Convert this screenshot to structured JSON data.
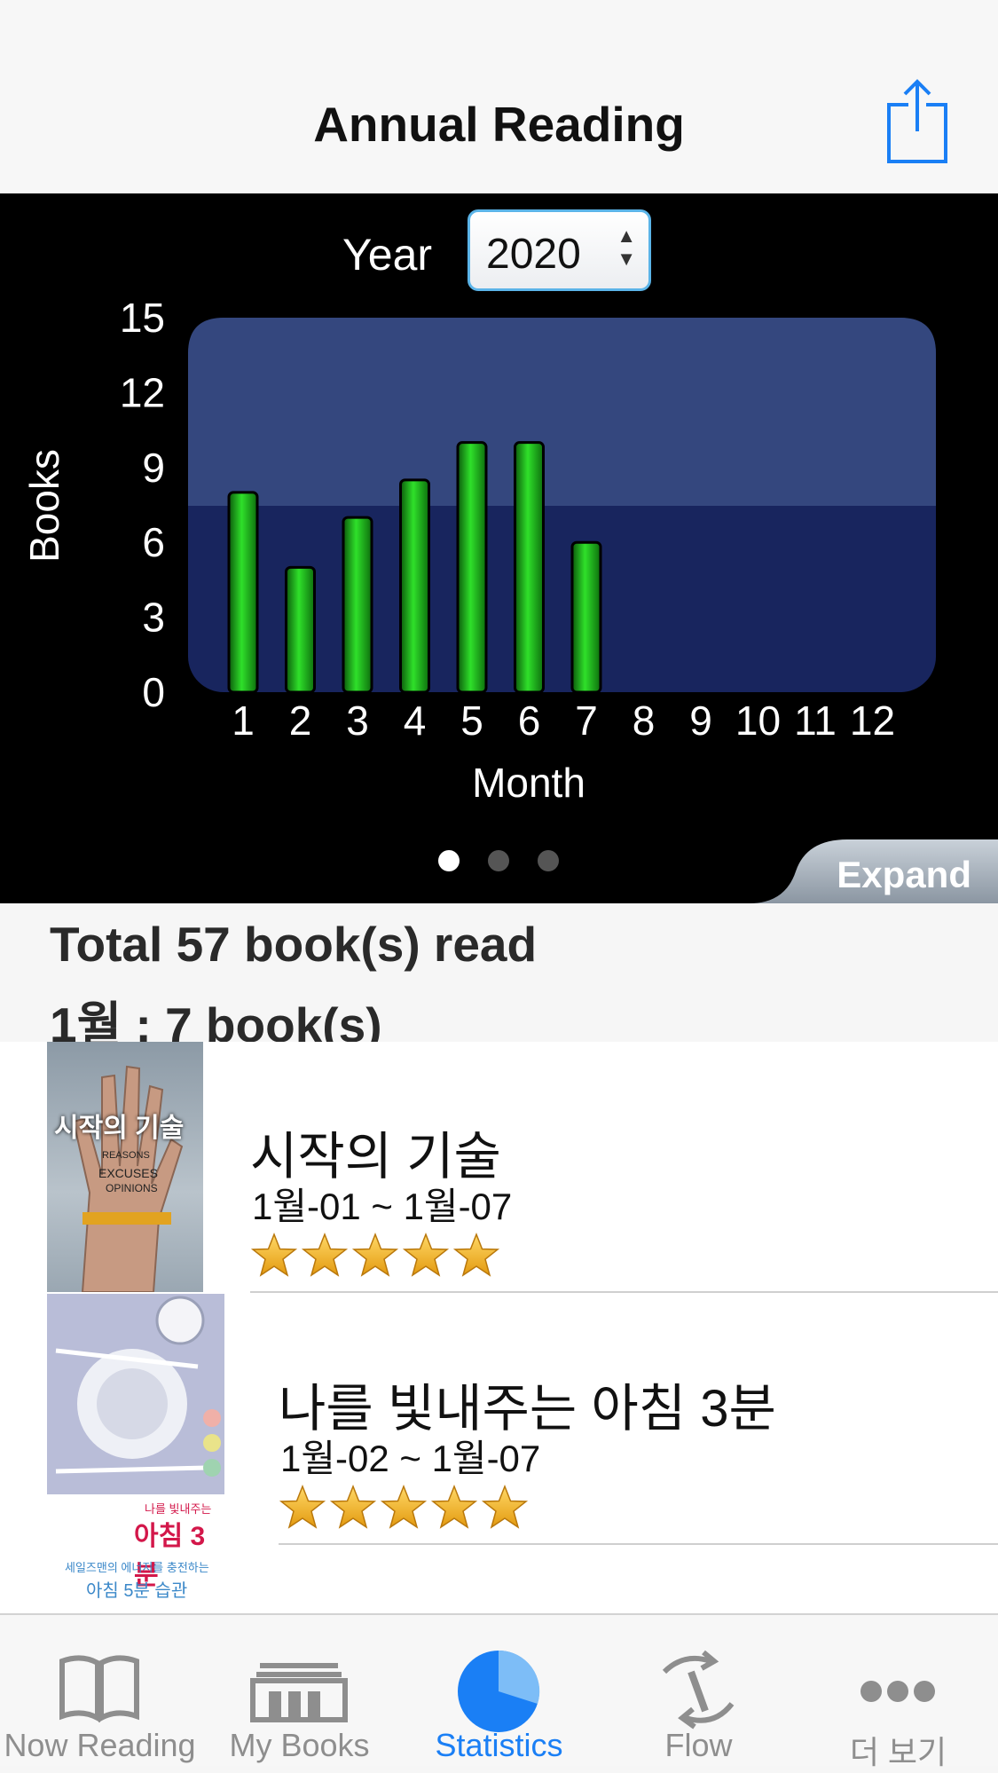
{
  "nav": {
    "title": "Annual Reading"
  },
  "year_picker": {
    "label": "Year",
    "value": "2020"
  },
  "chart_data": {
    "type": "bar",
    "title": "",
    "xlabel": "Month",
    "ylabel": "Books",
    "categories": [
      "1",
      "2",
      "3",
      "4",
      "5",
      "6",
      "7",
      "8",
      "9",
      "10",
      "11",
      "12"
    ],
    "values": [
      8,
      5,
      7,
      8.5,
      10,
      10,
      6,
      0,
      0,
      0,
      0,
      0
    ],
    "ylim": [
      0,
      15
    ],
    "yticks": [
      "0",
      "3",
      "6",
      "9",
      "12",
      "15"
    ],
    "grid": false,
    "bar_color": "#22c21e",
    "plot_bg": "#1a2a66"
  },
  "pager": {
    "count": 3,
    "active": 0
  },
  "expand": {
    "label": "Expand"
  },
  "summary": {
    "total": "Total 57 book(s) read",
    "month": "1월 : 7 book(s)"
  },
  "books": [
    {
      "title": "시작의 기술",
      "dates": "1월-01 ~ 1월-07",
      "rating": 5,
      "cover_text": "시작의 기술",
      "cover_words": [
        "EXCUSES",
        "OPINIONS",
        "REASONS"
      ]
    },
    {
      "title": "나를 빛내주는 아침 3분",
      "dates": "1월-02 ~ 1월-07",
      "rating": 5,
      "cover_text": "아침 3분",
      "cover_small": "나를 빛내주는",
      "cover_sub1": "세일즈맨의 에너지를 충전하는",
      "cover_sub2": "아침 5분 습관"
    }
  ],
  "tabs": [
    {
      "label": "Now Reading",
      "icon": "open-book-icon"
    },
    {
      "label": "My Books",
      "icon": "bookshelf-icon"
    },
    {
      "label": "Statistics",
      "icon": "pie-chart-icon",
      "active": true
    },
    {
      "label": "Flow",
      "icon": "flow-arrows-icon"
    },
    {
      "label": "더 보기",
      "icon": "more-dots-icon"
    }
  ],
  "colors": {
    "accent": "#1a7ff5",
    "star": "#f2b51c"
  }
}
